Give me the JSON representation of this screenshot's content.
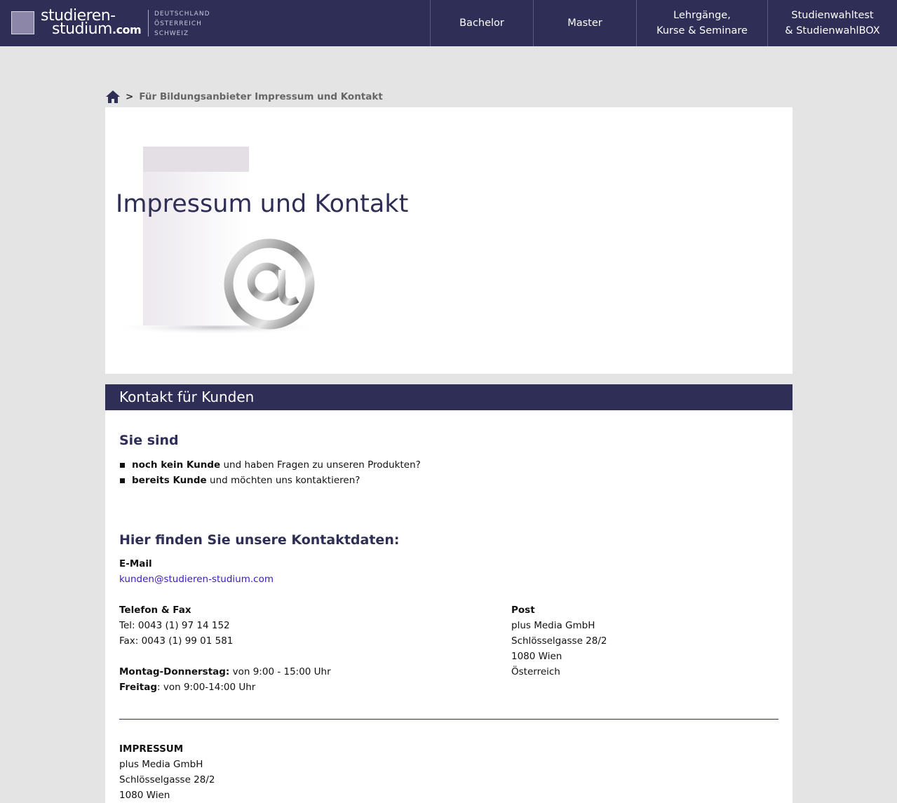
{
  "header": {
    "logo": {
      "line1": "studieren-",
      "line2": "studium",
      "suffix": ".com",
      "countries": [
        "DEUTSCHLAND",
        "ÖSTERREICH",
        "SCHWEIZ"
      ]
    },
    "nav": [
      {
        "lines": [
          "Bachelor"
        ]
      },
      {
        "lines": [
          "Master"
        ]
      },
      {
        "lines": [
          "Lehrgänge,",
          "Kurse & Seminare"
        ]
      },
      {
        "lines": [
          "Studienwahltest",
          "& StudienwahlBOX"
        ]
      }
    ],
    "background": "#2e2e57"
  },
  "breadcrumb": {
    "separator": ">",
    "current": "Für Bildungsanbieter Impressum und Kontakt"
  },
  "hero": {
    "title": "Impressum und Kontakt"
  },
  "section": {
    "bar_title": "Kontakt für Kunden",
    "heading1": "Sie sind",
    "bullets": [
      {
        "bold": "noch kein Kunde",
        "rest": " und haben Fragen zu unseren Produkten?"
      },
      {
        "bold": "bereits Kunde",
        "rest": " und möchten uns kontaktieren?"
      }
    ],
    "heading2": "Hier finden Sie unsere Kontaktdaten:",
    "email": {
      "label": "E-Mail",
      "address": "kunden@studieren-studium.com"
    },
    "phone": {
      "label": "Telefon & Fax",
      "tel": "Tel: 0043 (1) 97 14 152",
      "fax": "Fax: 0043 (1) 99 01 581"
    },
    "hours": {
      "weekdays_label": "Montag-Donnerstag:",
      "weekdays_value": " von 9:00 - 15:00 Uhr",
      "friday_label": "Freitag",
      "friday_value": ": von 9:00-14:00 Uhr"
    },
    "post": {
      "label": "Post",
      "lines": [
        "plus Media GmbH",
        "Schlösselgasse 28/2",
        "1080 Wien",
        "Österreich"
      ]
    },
    "impressum": {
      "label": "IMPRESSUM",
      "lines": [
        "plus Media GmbH",
        "Schlösselgasse 28/2",
        "1080 Wien"
      ]
    }
  },
  "colors": {
    "accent": "#2e2e57",
    "link": "#3b17c4",
    "page_background": "#e4e4e4"
  },
  "icons": {
    "breadcrumb_home": "home-icon",
    "hero_art": "at-sign-icon"
  }
}
